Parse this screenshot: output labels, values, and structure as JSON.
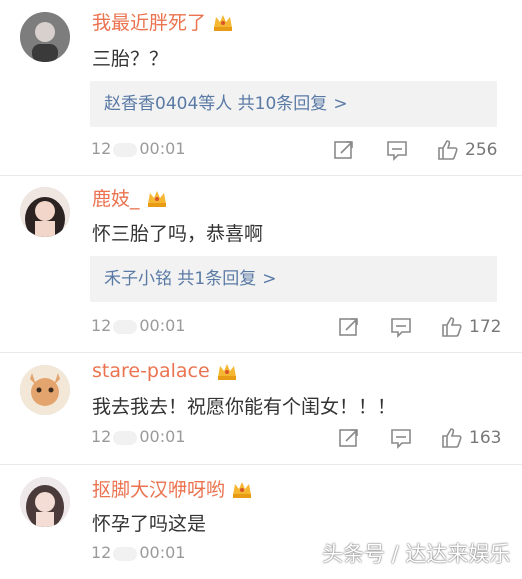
{
  "comments": [
    {
      "username": "我最近胖死了",
      "text": "三胎？？",
      "reply": "赵香香0404等人 共10条回复",
      "reply_arrow": ">",
      "time_prefix": "12",
      "time_suffix": "00:01",
      "likes": "256",
      "avatar_color": "#8a8a8a"
    },
    {
      "username": "鹿妓_",
      "text": "怀三胎了吗，恭喜啊",
      "reply": "禾子小铭 共1条回复",
      "reply_arrow": ">",
      "time_prefix": "12",
      "time_suffix": "00:01",
      "likes": "172",
      "avatar_color": "#c9a89a"
    },
    {
      "username": "stare-palace",
      "text": "我去我去！祝愿你能有个闺女！！！",
      "time_prefix": "12",
      "time_suffix": "00:01",
      "likes": "163",
      "avatar_color": "#d8b08a"
    },
    {
      "username": "抠脚大汉咿呀哟",
      "text": "怀孕了吗这是",
      "time_prefix": "12",
      "time_suffix": "00:01",
      "avatar_color": "#bcaeb0"
    }
  ],
  "icons": {
    "share": "share-icon",
    "comment": "comment-icon",
    "like": "thumbs-up-icon",
    "vip": "crown-icon"
  },
  "colors": {
    "username": "#eb7350",
    "reply_link": "#5a7aa5",
    "reply_bg": "#f2f2f2"
  },
  "watermark": "头条号 / 达达来娱乐"
}
